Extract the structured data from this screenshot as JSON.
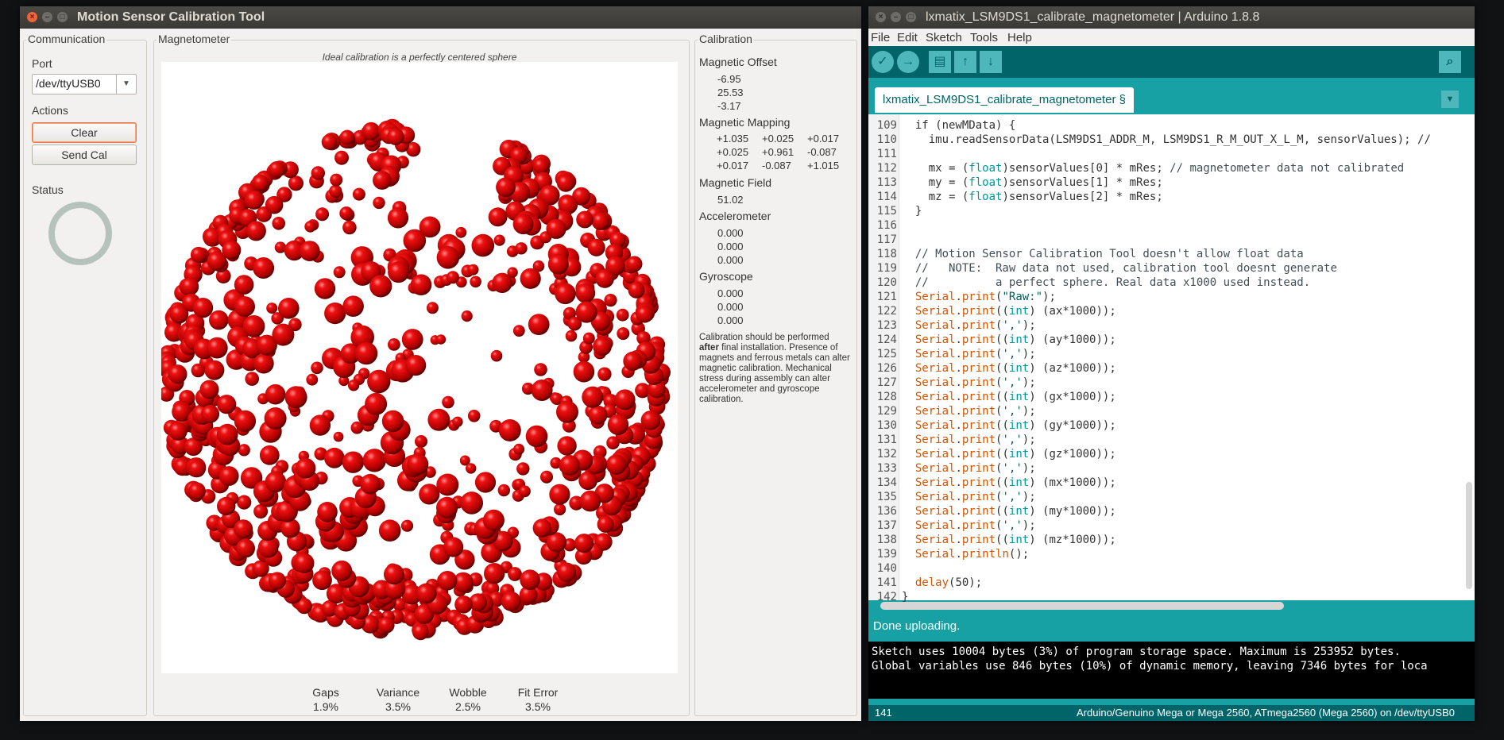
{
  "cal_window": {
    "title": "Motion Sensor Calibration Tool",
    "communication": {
      "group_label": "Communication",
      "port_label": "Port",
      "port_value": "/dev/ttyUSB0",
      "actions_label": "Actions",
      "clear_button": "Clear",
      "send_cal_button": "Send Cal",
      "status_label": "Status"
    },
    "magnetometer": {
      "group_label": "Magnetometer",
      "caption": "Ideal calibration is a perfectly centered sphere",
      "metrics": [
        {
          "label": "Gaps",
          "value": "1.9%"
        },
        {
          "label": "Variance",
          "value": "3.5%"
        },
        {
          "label": "Wobble",
          "value": "2.5%"
        },
        {
          "label": "Fit Error",
          "value": "3.5%"
        }
      ]
    },
    "calibration": {
      "group_label": "Calibration",
      "offset_label": "Magnetic Offset",
      "offset": [
        "-6.95",
        "25.53",
        "-3.17"
      ],
      "mapping_label": "Magnetic Mapping",
      "mapping": [
        [
          "+1.035",
          "+0.025",
          "+0.017"
        ],
        [
          "+0.025",
          "+0.961",
          "-0.087"
        ],
        [
          "+0.017",
          "-0.087",
          "+1.015"
        ]
      ],
      "field_label": "Magnetic Field",
      "field": "51.02",
      "accel_label": "Accelerometer",
      "accel": [
        "0.000",
        "0.000",
        "0.000"
      ],
      "gyro_label": "Gyroscope",
      "gyro": [
        "0.000",
        "0.000",
        "0.000"
      ],
      "note_pre": "Calibration should be performed ",
      "note_bold": "after",
      "note_post": " final installation.  Presence of magnets and ferrous metals can alter magnetic calibration. Mechanical stress during assembly can alter accelerometer and gyroscope calibration."
    }
  },
  "arduino_window": {
    "title": "lxmatix_LSM9DS1_calibrate_magnetometer | Arduino 1.8.8",
    "menu": [
      "File",
      "Edit",
      "Sketch",
      "Tools",
      "Help"
    ],
    "tab_label": "lxmatix_LSM9DS1_calibrate_magnetometer §",
    "code_lines": [
      {
        "n": "109",
        "parts": [
          [
            "",
            "  if (newMData) {"
          ]
        ]
      },
      {
        "n": "110",
        "parts": [
          [
            "",
            "    imu.readSensorData(LSM9DS1_ADDR_M, LSM9DS1_R_M_OUT_X_L_M, sensorValues); //"
          ]
        ]
      },
      {
        "n": "111",
        "parts": [
          [
            "",
            ""
          ]
        ]
      },
      {
        "n": "112",
        "parts": [
          [
            "",
            "    mx = ("
          ],
          [
            "ty",
            "float"
          ],
          [
            "",
            ")sensorValues[0] * mRes; "
          ],
          [
            "cm",
            "// magnetometer data not calibrated"
          ]
        ]
      },
      {
        "n": "113",
        "parts": [
          [
            "",
            "    my = ("
          ],
          [
            "ty",
            "float"
          ],
          [
            "",
            ")sensorValues[1] * mRes;"
          ]
        ]
      },
      {
        "n": "114",
        "parts": [
          [
            "",
            "    mz = ("
          ],
          [
            "ty",
            "float"
          ],
          [
            "",
            ")sensorValues[2] * mRes;"
          ]
        ]
      },
      {
        "n": "115",
        "parts": [
          [
            "",
            "  }"
          ]
        ]
      },
      {
        "n": "116",
        "parts": [
          [
            "",
            ""
          ]
        ]
      },
      {
        "n": "117",
        "parts": [
          [
            "",
            ""
          ]
        ]
      },
      {
        "n": "118",
        "parts": [
          [
            "cm",
            "  // Motion Sensor Calibration Tool doesn't allow float data"
          ]
        ]
      },
      {
        "n": "119",
        "parts": [
          [
            "cm",
            "  //   NOTE:  Raw data not used, calibration tool doesnt generate"
          ]
        ]
      },
      {
        "n": "120",
        "parts": [
          [
            "cm",
            "  //          a perfect sphere. Real data x1000 used instead."
          ]
        ]
      },
      {
        "n": "121",
        "parts": [
          [
            "",
            "  "
          ],
          [
            "kw",
            "Serial"
          ],
          [
            "",
            "."
          ],
          [
            "kw",
            "print"
          ],
          [
            "",
            "("
          ],
          [
            "str",
            "\"Raw:\""
          ],
          [
            "",
            ");"
          ]
        ]
      },
      {
        "n": "122",
        "parts": [
          [
            "",
            "  "
          ],
          [
            "kw",
            "Serial"
          ],
          [
            "",
            "."
          ],
          [
            "kw",
            "print"
          ],
          [
            "",
            "(("
          ],
          [
            "ty",
            "int"
          ],
          [
            "",
            ") (ax*1000));"
          ]
        ]
      },
      {
        "n": "123",
        "parts": [
          [
            "",
            "  "
          ],
          [
            "kw",
            "Serial"
          ],
          [
            "",
            "."
          ],
          [
            "kw",
            "print"
          ],
          [
            "",
            "("
          ],
          [
            "str",
            "','"
          ],
          [
            "",
            ");"
          ]
        ]
      },
      {
        "n": "124",
        "parts": [
          [
            "",
            "  "
          ],
          [
            "kw",
            "Serial"
          ],
          [
            "",
            "."
          ],
          [
            "kw",
            "print"
          ],
          [
            "",
            "(("
          ],
          [
            "ty",
            "int"
          ],
          [
            "",
            ") (ay*1000));"
          ]
        ]
      },
      {
        "n": "125",
        "parts": [
          [
            "",
            "  "
          ],
          [
            "kw",
            "Serial"
          ],
          [
            "",
            "."
          ],
          [
            "kw",
            "print"
          ],
          [
            "",
            "("
          ],
          [
            "str",
            "','"
          ],
          [
            "",
            ");"
          ]
        ]
      },
      {
        "n": "126",
        "parts": [
          [
            "",
            "  "
          ],
          [
            "kw",
            "Serial"
          ],
          [
            "",
            "."
          ],
          [
            "kw",
            "print"
          ],
          [
            "",
            "(("
          ],
          [
            "ty",
            "int"
          ],
          [
            "",
            ") (az*1000));"
          ]
        ]
      },
      {
        "n": "127",
        "parts": [
          [
            "",
            "  "
          ],
          [
            "kw",
            "Serial"
          ],
          [
            "",
            "."
          ],
          [
            "kw",
            "print"
          ],
          [
            "",
            "("
          ],
          [
            "str",
            "','"
          ],
          [
            "",
            ");"
          ]
        ]
      },
      {
        "n": "128",
        "parts": [
          [
            "",
            "  "
          ],
          [
            "kw",
            "Serial"
          ],
          [
            "",
            "."
          ],
          [
            "kw",
            "print"
          ],
          [
            "",
            "(("
          ],
          [
            "ty",
            "int"
          ],
          [
            "",
            ") (gx*1000));"
          ]
        ]
      },
      {
        "n": "129",
        "parts": [
          [
            "",
            "  "
          ],
          [
            "kw",
            "Serial"
          ],
          [
            "",
            "."
          ],
          [
            "kw",
            "print"
          ],
          [
            "",
            "("
          ],
          [
            "str",
            "','"
          ],
          [
            "",
            ");"
          ]
        ]
      },
      {
        "n": "130",
        "parts": [
          [
            "",
            "  "
          ],
          [
            "kw",
            "Serial"
          ],
          [
            "",
            "."
          ],
          [
            "kw",
            "print"
          ],
          [
            "",
            "(("
          ],
          [
            "ty",
            "int"
          ],
          [
            "",
            ") (gy*1000));"
          ]
        ]
      },
      {
        "n": "131",
        "parts": [
          [
            "",
            "  "
          ],
          [
            "kw",
            "Serial"
          ],
          [
            "",
            "."
          ],
          [
            "kw",
            "print"
          ],
          [
            "",
            "("
          ],
          [
            "str",
            "','"
          ],
          [
            "",
            ");"
          ]
        ]
      },
      {
        "n": "132",
        "parts": [
          [
            "",
            "  "
          ],
          [
            "kw",
            "Serial"
          ],
          [
            "",
            "."
          ],
          [
            "kw",
            "print"
          ],
          [
            "",
            "(("
          ],
          [
            "ty",
            "int"
          ],
          [
            "",
            ") (gz*1000));"
          ]
        ]
      },
      {
        "n": "133",
        "parts": [
          [
            "",
            "  "
          ],
          [
            "kw",
            "Serial"
          ],
          [
            "",
            "."
          ],
          [
            "kw",
            "print"
          ],
          [
            "",
            "("
          ],
          [
            "str",
            "','"
          ],
          [
            "",
            ");"
          ]
        ]
      },
      {
        "n": "134",
        "parts": [
          [
            "",
            "  "
          ],
          [
            "kw",
            "Serial"
          ],
          [
            "",
            "."
          ],
          [
            "kw",
            "print"
          ],
          [
            "",
            "(("
          ],
          [
            "ty",
            "int"
          ],
          [
            "",
            ") (mx*1000));"
          ]
        ]
      },
      {
        "n": "135",
        "parts": [
          [
            "",
            "  "
          ],
          [
            "kw",
            "Serial"
          ],
          [
            "",
            "."
          ],
          [
            "kw",
            "print"
          ],
          [
            "",
            "("
          ],
          [
            "str",
            "','"
          ],
          [
            "",
            ");"
          ]
        ]
      },
      {
        "n": "136",
        "parts": [
          [
            "",
            "  "
          ],
          [
            "kw",
            "Serial"
          ],
          [
            "",
            "."
          ],
          [
            "kw",
            "print"
          ],
          [
            "",
            "(("
          ],
          [
            "ty",
            "int"
          ],
          [
            "",
            ") (my*1000));"
          ]
        ]
      },
      {
        "n": "137",
        "parts": [
          [
            "",
            "  "
          ],
          [
            "kw",
            "Serial"
          ],
          [
            "",
            "."
          ],
          [
            "kw",
            "print"
          ],
          [
            "",
            "("
          ],
          [
            "str",
            "','"
          ],
          [
            "",
            ");"
          ]
        ]
      },
      {
        "n": "138",
        "parts": [
          [
            "",
            "  "
          ],
          [
            "kw",
            "Serial"
          ],
          [
            "",
            "."
          ],
          [
            "kw",
            "print"
          ],
          [
            "",
            "(("
          ],
          [
            "ty",
            "int"
          ],
          [
            "",
            ") (mz*1000));"
          ]
        ]
      },
      {
        "n": "139",
        "parts": [
          [
            "",
            "  "
          ],
          [
            "kw",
            "Serial"
          ],
          [
            "",
            "."
          ],
          [
            "kw",
            "println"
          ],
          [
            "",
            "();"
          ]
        ]
      },
      {
        "n": "140",
        "parts": [
          [
            "",
            ""
          ]
        ]
      },
      {
        "n": "141",
        "parts": [
          [
            "",
            "  "
          ],
          [
            "kw",
            "delay"
          ],
          [
            "",
            "(50);"
          ]
        ]
      },
      {
        "n": "142",
        "parts": [
          [
            "",
            "}"
          ]
        ]
      }
    ],
    "message": "Done uploading.",
    "console": [
      "Sketch uses 10004 bytes (3%) of program storage space. Maximum is 253952 bytes.",
      "Global variables use 846 bytes (10%) of dynamic memory, leaving 7346 bytes for loca"
    ],
    "footer_line": "141",
    "footer_board": "Arduino/Genuino Mega or Mega 2560, ATmega2560 (Mega 2560) on /dev/ttyUSB0"
  },
  "colors": {
    "sphere_red": "#cc0000",
    "arduino_teal": "#17a1a5",
    "arduino_dark": "#006468",
    "status_ring": "#b6c3bc"
  }
}
